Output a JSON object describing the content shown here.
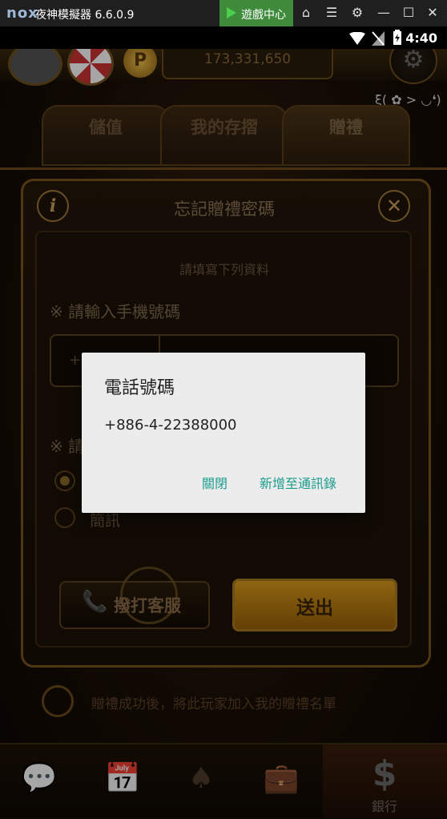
{
  "emulator": {
    "logo": "nox",
    "title": "夜神模擬器 6.6.0.9",
    "game_center": "遊戲中心",
    "icons": [
      "home-icon",
      "menu-icon",
      "gear-icon",
      "minimize-icon",
      "maximize-icon",
      "close-icon"
    ]
  },
  "status_bar": {
    "time": "4:40"
  },
  "header": {
    "coins": "173,331,650",
    "emoticon": "ξ( ✿ > ◡❛)"
  },
  "tabs": [
    {
      "label": "儲值"
    },
    {
      "label": "我的存摺"
    },
    {
      "label": "贈禮",
      "active": true
    }
  ],
  "dialog": {
    "title": "忘記贈禮密碼",
    "fill_hint": "請填寫下列資料",
    "phone_label": "※ 請輸入手機號碼",
    "country_code": "+8",
    "verify_label": "※ 請",
    "sms_label": "簡訊",
    "call_label": "撥打客服",
    "submit_label": "送出"
  },
  "gift_hint": "贈禮成功後，將此玩家加入我的贈禮名單",
  "bottom_nav": {
    "bank_label": "銀行",
    "bank_icon": "$"
  },
  "android_dialog": {
    "title": "電話號碼",
    "number": "+886-4-22388000",
    "close_label": "關閉",
    "add_label": "新增至通訊錄"
  },
  "colors": {
    "accent_teal": "#1b9c8c",
    "gold": "#d99a1a",
    "title_bar": "#1f1f1f"
  }
}
